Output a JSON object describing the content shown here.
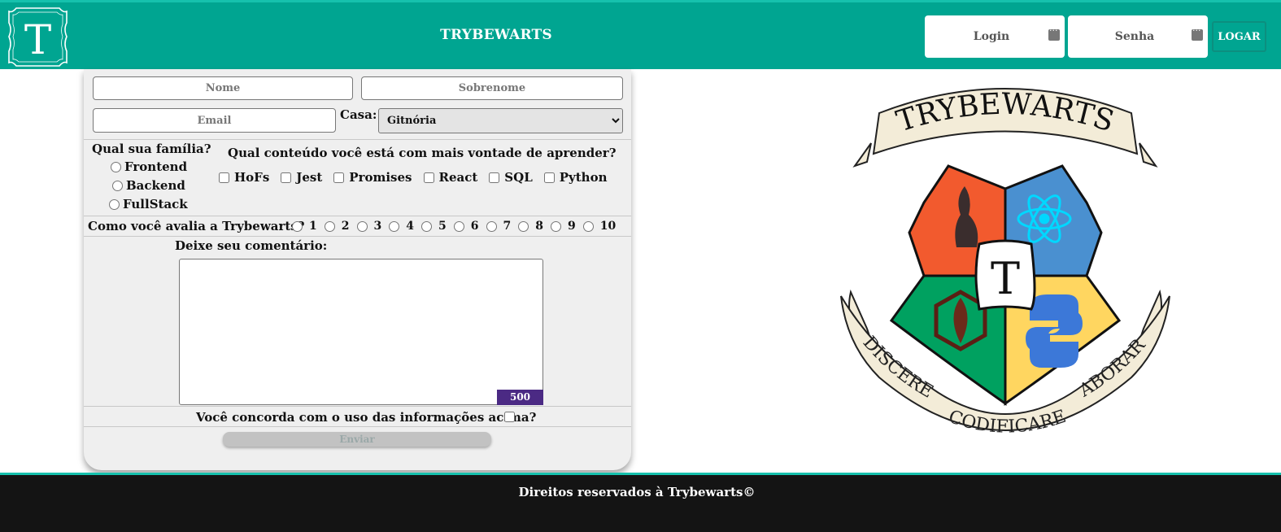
{
  "header": {
    "logo_letter": "T",
    "title": "TRYBEWARTS",
    "login_placeholder": "Login",
    "password_placeholder": "Senha",
    "login_button": "LOGAR"
  },
  "form": {
    "name_placeholder": "Nome",
    "lastname_placeholder": "Sobrenome",
    "email_placeholder": "Email",
    "house_label": "Casa:",
    "house_selected": "Gitnória",
    "family_heading": "Qual sua família?",
    "families": [
      "Frontend",
      "Backend",
      "FullStack"
    ],
    "content_heading": "Qual conteúdo você está com mais vontade de aprender?",
    "contents": [
      "HoFs",
      "Jest",
      "Promises",
      "React",
      "SQL",
      "Python"
    ],
    "rate_label": "Como você avalia a Trybewarts?",
    "rates": [
      "1",
      "2",
      "3",
      "4",
      "5",
      "6",
      "7",
      "8",
      "9",
      "10"
    ],
    "comment_label": "Deixe seu comentário:",
    "counter": "500",
    "agreement_label": "Você concorda com o uso das informações acima?",
    "submit_label": "Enviar"
  },
  "crest": {
    "banner_top": "TRYBEWARTS",
    "center_letter": "T",
    "motto": [
      "DISCERE",
      "CODIFICARE",
      "LABORARE"
    ]
  },
  "footer": {
    "text": "Direitos reservados à Trybewarts©"
  },
  "colors": {
    "accent": "#00a591",
    "footer_bg": "#141414",
    "counter_bg": "#4b2a84"
  }
}
